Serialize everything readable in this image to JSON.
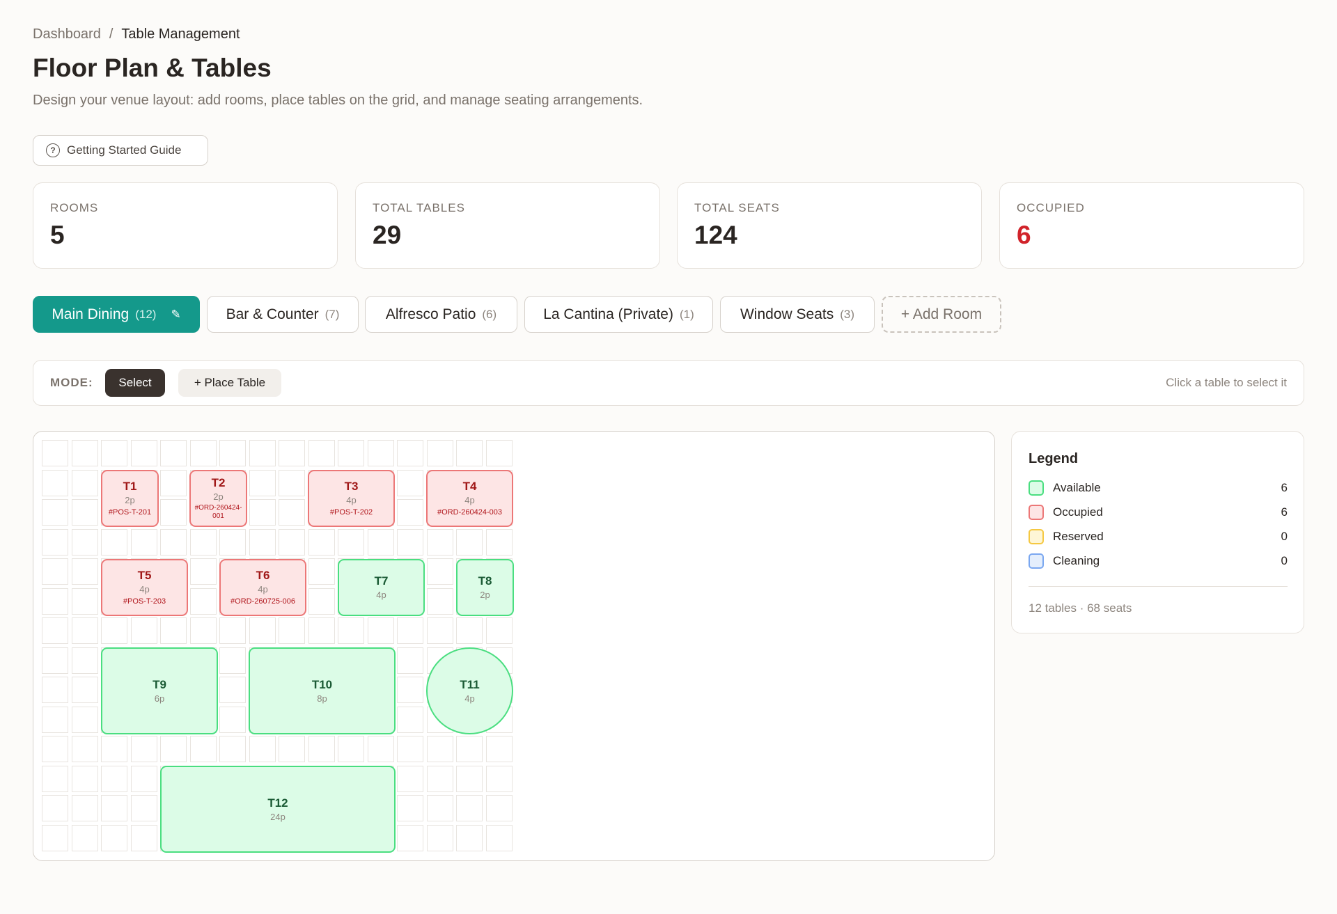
{
  "breadcrumb": {
    "parent": "Dashboard",
    "separator": "/",
    "current": "Table Management"
  },
  "page": {
    "title": "Floor Plan & Tables",
    "subtitle": "Design your venue layout: add rooms, place tables on the grid, and manage seating arrangements."
  },
  "guide_button": {
    "label": "Getting Started Guide",
    "icon": "question-circle-icon"
  },
  "stats": [
    {
      "label": "ROOMS",
      "value": "5"
    },
    {
      "label": "TOTAL TABLES",
      "value": "29"
    },
    {
      "label": "TOTAL SEATS",
      "value": "124"
    },
    {
      "label": "OCCUPIED",
      "value": "6",
      "color": "#d1232a"
    }
  ],
  "rooms": [
    {
      "name": "Main Dining",
      "count": "(12)",
      "active": true
    },
    {
      "name": "Bar & Counter",
      "count": "(7)"
    },
    {
      "name": "Alfresco Patio",
      "count": "(6)"
    },
    {
      "name": "La Cantina (Private)",
      "count": "(1)"
    },
    {
      "name": "Window Seats",
      "count": "(3)"
    }
  ],
  "add_room_label": "+ Add Room",
  "mode_bar": {
    "label": "MODE:",
    "select_label": "Select",
    "place_label": "+ Place Table",
    "hint": "Click a table to select it"
  },
  "tables": [
    {
      "name": "T1",
      "seats": "2p",
      "order": "#POS-T-201",
      "status": "occupied"
    },
    {
      "name": "T2",
      "seats": "2p",
      "order": "#ORD-260424-001",
      "status": "occupied"
    },
    {
      "name": "T3",
      "seats": "4p",
      "order": "#POS-T-202",
      "status": "occupied"
    },
    {
      "name": "T4",
      "seats": "4p",
      "order": "#ORD-260424-003",
      "status": "occupied"
    },
    {
      "name": "T5",
      "seats": "4p",
      "order": "#POS-T-203",
      "status": "occupied"
    },
    {
      "name": "T6",
      "seats": "4p",
      "order": "#ORD-260725-006",
      "status": "occupied"
    },
    {
      "name": "T7",
      "seats": "4p",
      "status": "available"
    },
    {
      "name": "T8",
      "seats": "2p",
      "status": "available"
    },
    {
      "name": "T9",
      "seats": "6p",
      "status": "available"
    },
    {
      "name": "T10",
      "seats": "8p",
      "status": "available"
    },
    {
      "name": "T11",
      "seats": "4p",
      "status": "available",
      "shape": "round"
    },
    {
      "name": "T12",
      "seats": "24p",
      "status": "available"
    }
  ],
  "legend": {
    "title": "Legend",
    "items": [
      {
        "label": "Available",
        "count": "6",
        "color": "#4ade80",
        "fill": "#dcfce7"
      },
      {
        "label": "Occupied",
        "count": "6",
        "color": "#ec7777",
        "fill": "#fde5e5"
      },
      {
        "label": "Reserved",
        "count": "0",
        "color": "#f5c842",
        "fill": "#fef6d6"
      },
      {
        "label": "Cleaning",
        "count": "0",
        "color": "#7aa7f0",
        "fill": "#e4eefc"
      }
    ],
    "summary": "12 tables · 68 seats"
  }
}
